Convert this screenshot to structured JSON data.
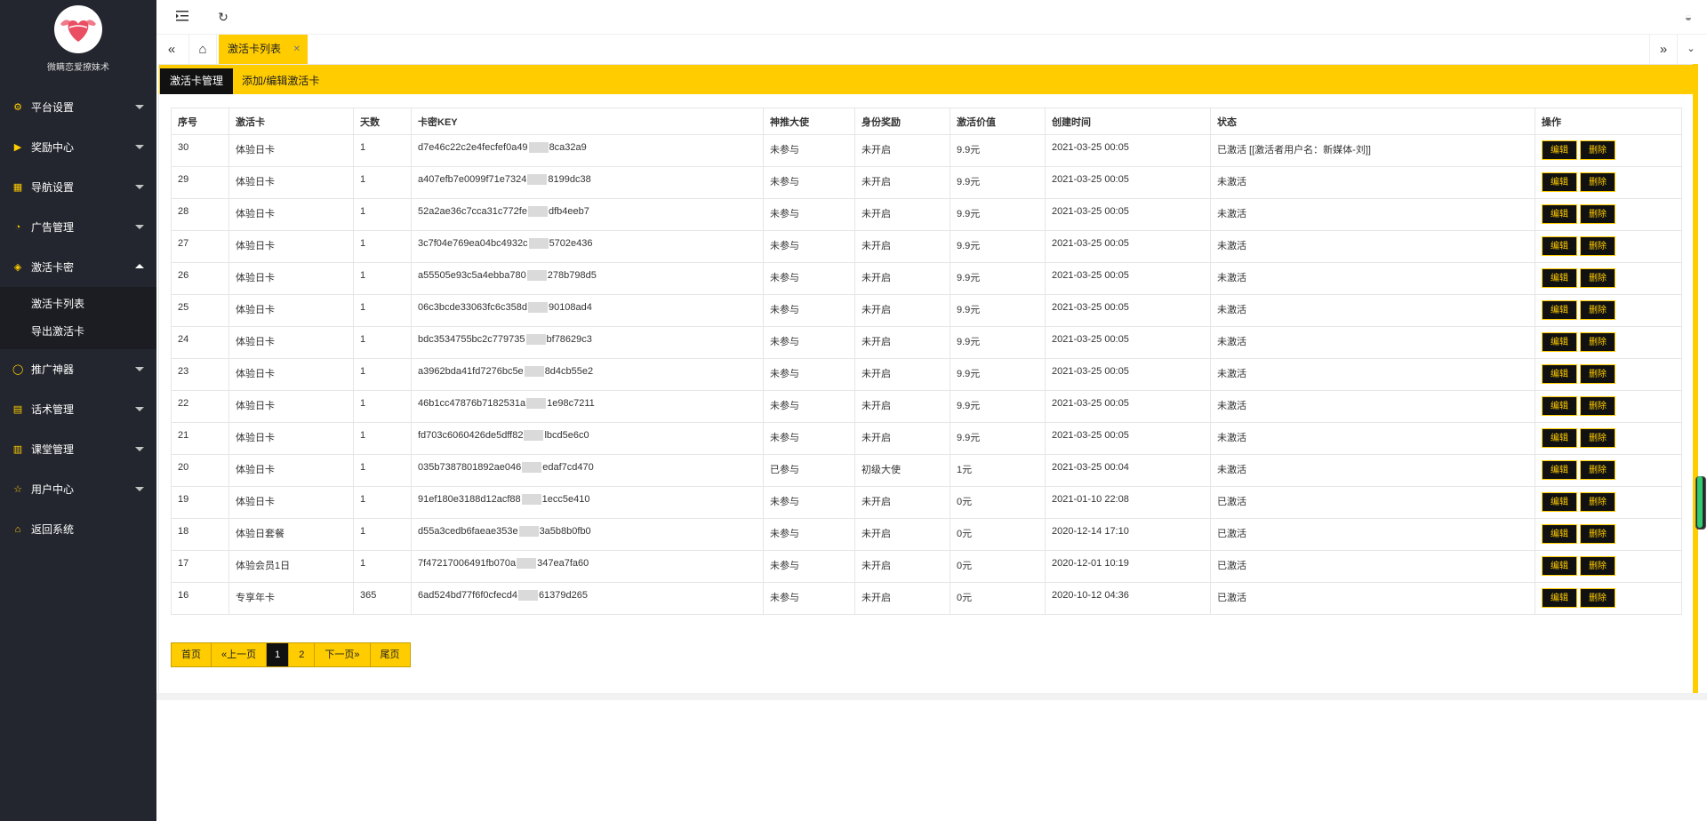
{
  "sidebar": {
    "logo_text": "微瞒恋爱撩妹术",
    "items": [
      {
        "label": "平台设置",
        "icon": "gear-icon",
        "glyph": "⚙"
      },
      {
        "label": "奖励中心",
        "icon": "video-icon",
        "glyph": "▶"
      },
      {
        "label": "导航设置",
        "icon": "nav-icon",
        "glyph": "▦"
      },
      {
        "label": "广告管理",
        "icon": "dashboard-icon",
        "glyph": "◔"
      },
      {
        "label": "激活卡密",
        "icon": "cube-icon",
        "glyph": "◈",
        "expanded": true
      },
      {
        "label": "推广神器",
        "icon": "chat-icon",
        "glyph": "◯"
      },
      {
        "label": "话术管理",
        "icon": "doc-icon",
        "glyph": "▤"
      },
      {
        "label": "课堂管理",
        "icon": "book-icon",
        "glyph": "▥"
      },
      {
        "label": "用户中心",
        "icon": "star-icon",
        "glyph": "☆"
      },
      {
        "label": "返回系统",
        "icon": "home-icon",
        "glyph": "⌂"
      }
    ],
    "submenu": [
      "激活卡列表",
      "导出激活卡"
    ]
  },
  "header": {
    "menu_toggle_icon": "indent-icon",
    "refresh_icon": "refresh-icon",
    "theme_icon": "palette-icon"
  },
  "tabs": {
    "active_label": "激活卡列表"
  },
  "card_tabs": [
    "激活卡管理",
    "添加/编辑激活卡"
  ],
  "table": {
    "headers": [
      "序号",
      "激活卡",
      "天数",
      "卡密KEY",
      "神推大使",
      "身份奖励",
      "激活价值",
      "创建时间",
      "状态",
      "操作"
    ],
    "edit_label": "编辑",
    "delete_label": "删除",
    "rows": [
      {
        "id": "30",
        "card": "体验日卡",
        "days": "1",
        "key_a": "d7e46c22c2e4fecfef0a49",
        "key_b": "8ca32a9",
        "promoter": "未参与",
        "reward": "未开启",
        "value": "9.9元",
        "created": "2021-03-25 00:05",
        "status": "已激活 [[激活者用户名：新媒体-刘]]"
      },
      {
        "id": "29",
        "card": "体验日卡",
        "days": "1",
        "key_a": "a407efb7e0099f71e7324",
        "key_b": "8199dc38",
        "promoter": "未参与",
        "reward": "未开启",
        "value": "9.9元",
        "created": "2021-03-25 00:05",
        "status": "未激活"
      },
      {
        "id": "28",
        "card": "体验日卡",
        "days": "1",
        "key_a": "52a2ae36c7cca31c772fe",
        "key_b": "dfb4eeb7",
        "promoter": "未参与",
        "reward": "未开启",
        "value": "9.9元",
        "created": "2021-03-25 00:05",
        "status": "未激活"
      },
      {
        "id": "27",
        "card": "体验日卡",
        "days": "1",
        "key_a": "3c7f04e769ea04bc4932c",
        "key_b": "5702e436",
        "promoter": "未参与",
        "reward": "未开启",
        "value": "9.9元",
        "created": "2021-03-25 00:05",
        "status": "未激活"
      },
      {
        "id": "26",
        "card": "体验日卡",
        "days": "1",
        "key_a": "a55505e93c5a4ebba780",
        "key_b": "278b798d5",
        "promoter": "未参与",
        "reward": "未开启",
        "value": "9.9元",
        "created": "2021-03-25 00:05",
        "status": "未激活"
      },
      {
        "id": "25",
        "card": "体验日卡",
        "days": "1",
        "key_a": "06c3bcde33063fc6c358d",
        "key_b": "90108ad4",
        "promoter": "未参与",
        "reward": "未开启",
        "value": "9.9元",
        "created": "2021-03-25 00:05",
        "status": "未激活"
      },
      {
        "id": "24",
        "card": "体验日卡",
        "days": "1",
        "key_a": "bdc3534755bc2c779735",
        "key_b": "bf78629c3",
        "promoter": "未参与",
        "reward": "未开启",
        "value": "9.9元",
        "created": "2021-03-25 00:05",
        "status": "未激活"
      },
      {
        "id": "23",
        "card": "体验日卡",
        "days": "1",
        "key_a": "a3962bda41fd7276bc5e",
        "key_b": "8d4cb55e2",
        "promoter": "未参与",
        "reward": "未开启",
        "value": "9.9元",
        "created": "2021-03-25 00:05",
        "status": "未激活"
      },
      {
        "id": "22",
        "card": "体验日卡",
        "days": "1",
        "key_a": "46b1cc47876b7182531a",
        "key_b": "1e98c7211",
        "promoter": "未参与",
        "reward": "未开启",
        "value": "9.9元",
        "created": "2021-03-25 00:05",
        "status": "未激活"
      },
      {
        "id": "21",
        "card": "体验日卡",
        "days": "1",
        "key_a": "fd703c6060426de5dff82",
        "key_b": "lbcd5e6c0",
        "promoter": "未参与",
        "reward": "未开启",
        "value": "9.9元",
        "created": "2021-03-25 00:05",
        "status": "未激活"
      },
      {
        "id": "20",
        "card": "体验日卡",
        "days": "1",
        "key_a": "035b7387801892ae046",
        "key_b": "edaf7cd470",
        "promoter": "已参与",
        "reward": "初级大使",
        "value": "1元",
        "created": "2021-03-25 00:04",
        "status": "未激活"
      },
      {
        "id": "19",
        "card": "体验日卡",
        "days": "1",
        "key_a": "91ef180e3188d12acf88",
        "key_b": "1ecc5e410",
        "promoter": "未参与",
        "reward": "未开启",
        "value": "0元",
        "created": "2021-01-10 22:08",
        "status": "已激活"
      },
      {
        "id": "18",
        "card": "体验日套餐",
        "days": "1",
        "key_a": "d55a3cedb6faeae353e",
        "key_b": "3a5b8b0fb0",
        "promoter": "未参与",
        "reward": "未开启",
        "value": "0元",
        "created": "2020-12-14 17:10",
        "status": "已激活"
      },
      {
        "id": "17",
        "card": "体验会员1日",
        "days": "1",
        "key_a": "7f47217006491fb070a",
        "key_b": "347ea7fa60",
        "promoter": "未参与",
        "reward": "未开启",
        "value": "0元",
        "created": "2020-12-01 10:19",
        "status": "已激活"
      },
      {
        "id": "16",
        "card": "专享年卡",
        "days": "365",
        "key_a": "6ad524bd77f6f0cfecd4",
        "key_b": "61379d265",
        "promoter": "未参与",
        "reward": "未开启",
        "value": "0元",
        "created": "2020-10-12 04:36",
        "status": "已激活"
      }
    ]
  },
  "pager": {
    "first": "首页",
    "prev": "«上一页",
    "pages": [
      "1",
      "2"
    ],
    "current": "1",
    "next": "下一页»",
    "last": "尾页"
  },
  "colors": {
    "accent": "#ffcc00",
    "sidebar_bg": "#23262e",
    "dark": "#111111"
  }
}
